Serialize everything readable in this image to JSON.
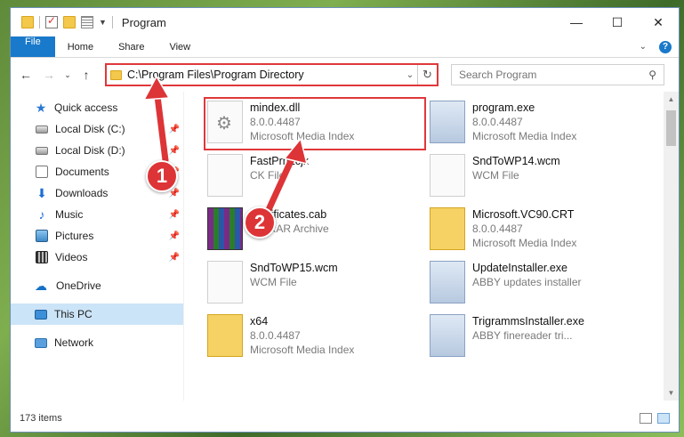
{
  "window": {
    "title": "Program",
    "controls": {
      "minimize": "—",
      "maximize": "☐",
      "close": "✕"
    }
  },
  "ribbon": {
    "tabs": [
      "File",
      "Home",
      "Share",
      "View"
    ]
  },
  "address": {
    "path": "C:\\Program Files\\Program Directory"
  },
  "search": {
    "placeholder": "Search Program"
  },
  "sidebar": {
    "quick_access": "Quick access",
    "items": [
      {
        "label": "Local Disk (C:)",
        "icon": "disk-icon"
      },
      {
        "label": "Local Disk (D:)",
        "icon": "disk-icon"
      },
      {
        "label": "Documents",
        "icon": "documents-icon"
      },
      {
        "label": "Downloads",
        "icon": "downloads-icon"
      },
      {
        "label": "Music",
        "icon": "music-icon"
      },
      {
        "label": "Pictures",
        "icon": "pictures-icon"
      },
      {
        "label": "Videos",
        "icon": "videos-icon"
      }
    ],
    "onedrive": "OneDrive",
    "this_pc": "This PC",
    "network": "Network"
  },
  "files": [
    {
      "name": "mindex.dll",
      "line2": "8.0.0.4487",
      "line3": "Microsoft Media Index",
      "icon": "dll"
    },
    {
      "name": "program.exe",
      "line2": "8.0.0.4487",
      "line3": "Microsoft Media Index",
      "icon": "exe"
    },
    {
      "name": "FastPrnLcjk",
      "line2": "CK File",
      "line3": "",
      "icon": "blank"
    },
    {
      "name": "SndToWP14.wcm",
      "line2": "WCM File",
      "line3": "",
      "icon": "blank"
    },
    {
      "name": "Certificates.cab",
      "line2": "WinRAR Archive",
      "line3": "",
      "icon": "cab"
    },
    {
      "name": "Microsoft.VC90.CRT",
      "line2": "8.0.0.4487",
      "line3": "Microsoft Media Index",
      "icon": "fold"
    },
    {
      "name": "SndToWP15.wcm",
      "line2": "WCM File",
      "line3": "",
      "icon": "blank"
    },
    {
      "name": "UpdateInstaller.exe",
      "line2": "ABBY updates installer",
      "line3": "",
      "icon": "exe"
    },
    {
      "name": "x64",
      "line2": "8.0.0.4487",
      "line3": "Microsoft Media Index",
      "icon": "fold"
    },
    {
      "name": "TrigrammsInstaller.exe",
      "line2": "ABBY finereader tri...",
      "line3": "",
      "icon": "exe"
    }
  ],
  "status": {
    "item_count": "173 items"
  },
  "annotations": {
    "badge1": "1",
    "badge2": "2",
    "color": "#dd3437"
  }
}
